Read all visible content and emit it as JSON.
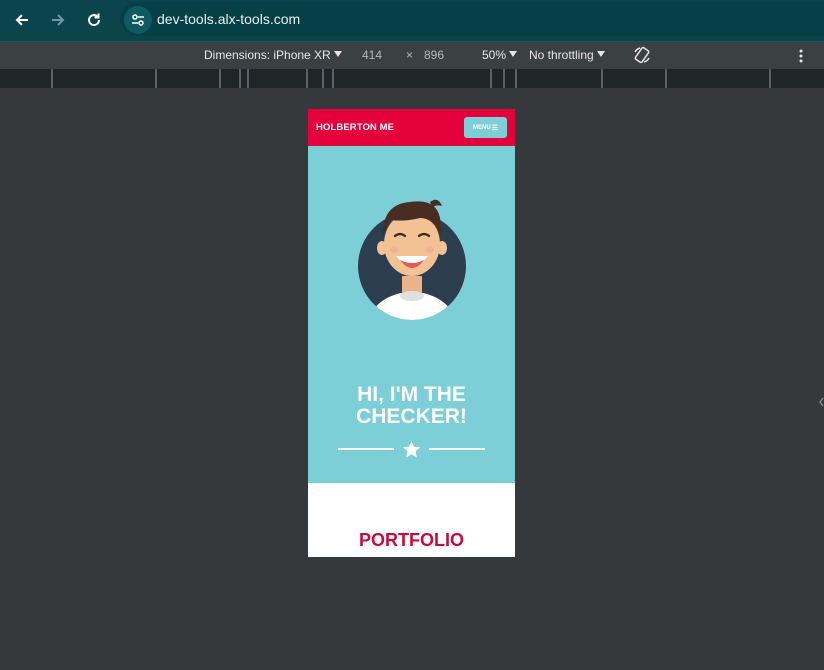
{
  "browser": {
    "url": "dev-tools.alx-tools.com"
  },
  "devtools": {
    "dimensions_label": "Dimensions: iPhone XR",
    "width": "414",
    "times": "×",
    "height": "896",
    "zoom": "50%",
    "throttling": "No throttling"
  },
  "page": {
    "brand": "HOLBERTON ME",
    "menu_label": "MENU",
    "menu_icon": "☰",
    "hero_title_line1": "HI, I'M THE",
    "hero_title_line2": "CHECKER!",
    "portfolio": "PORTFOLIO"
  },
  "colors": {
    "accent_red": "#e4003a",
    "teal": "#7ccfd6",
    "toolbar": "#0b444b"
  }
}
